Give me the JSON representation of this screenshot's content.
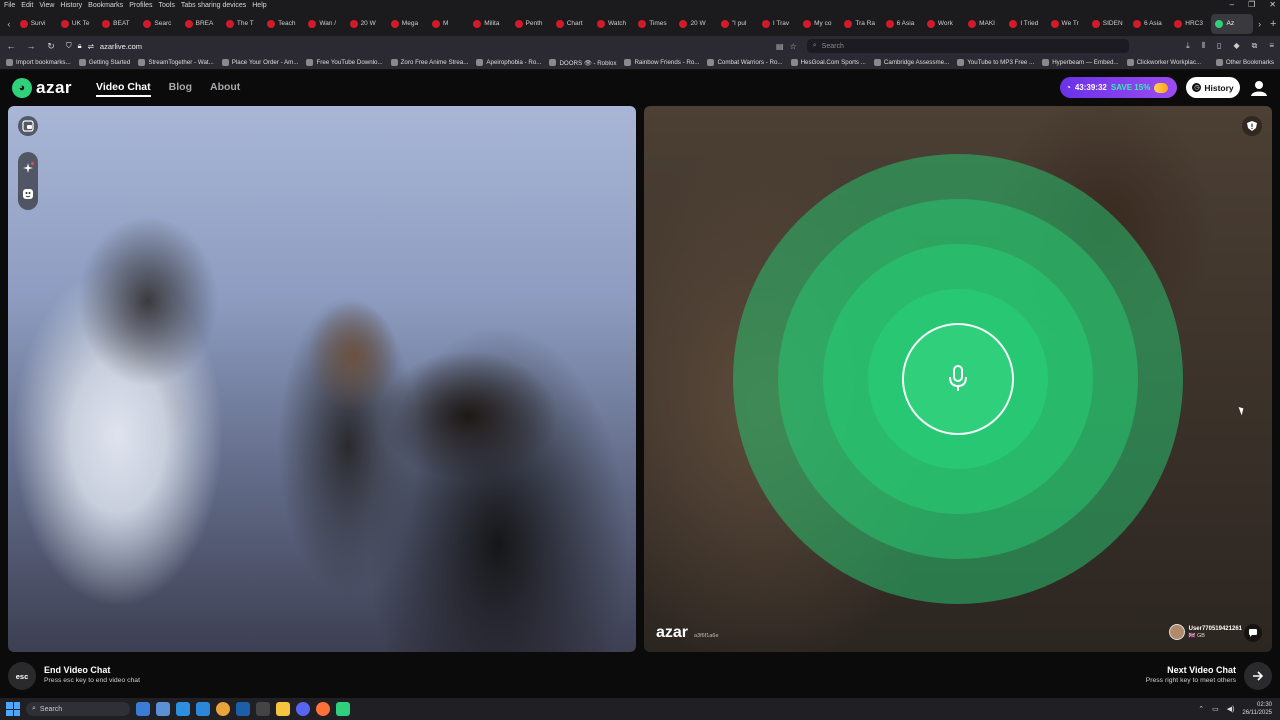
{
  "browser": {
    "menu": [
      "File",
      "Edit",
      "View",
      "History",
      "Bookmarks",
      "Profiles",
      "Tools",
      "Tabs sharing devices",
      "Help"
    ],
    "tabs": [
      "Survi",
      "UK Te",
      "BEAT",
      "Searc",
      "BREA",
      "The T",
      "Teach",
      "Wan /",
      "20 W",
      "Mega",
      "M",
      "Milita",
      "Penth",
      "Chart",
      "Watch",
      "Times",
      "20 W",
      "\"I pul",
      "I Trav",
      "My co",
      "Tra Ra",
      "6 Asia",
      "Work",
      "MAKI",
      "I Tried",
      "We Tr",
      "SIDEN",
      "6 Asia",
      "HRC3",
      "Az"
    ],
    "active_tab": "Az",
    "url": "azarlive.com",
    "search_placeholder": "Search",
    "bookmarks": [
      "Import bookmarks...",
      "Getting Started",
      "StreamTogether - Wat...",
      "Place Your Order - Am...",
      "Free YouTube Downlo...",
      "Zoro Free Anime Strea...",
      "Apeirophobia - Ro...",
      "DOORS 👁 - Roblox",
      "Rainbow Friends - Ro...",
      "Combat Warriors - Ro...",
      "HesGoal.Com Sports ...",
      "Cambridge Assessme...",
      "YouTube to MP3 Free ...",
      "Hyperbeam — Embed...",
      "Clickworker Workplac..."
    ],
    "other_bookmarks": "Other Bookmarks"
  },
  "header": {
    "logo_text": "azar",
    "nav": [
      {
        "label": "Video Chat",
        "active": true
      },
      {
        "label": "Blog",
        "active": false
      },
      {
        "label": "About",
        "active": false
      }
    ],
    "promo_timer": "43:39:32",
    "promo_save": "SAVE 15%",
    "history_label": "History"
  },
  "remote": {
    "watermark": "azar",
    "watermark_id": "a3f6f1a6e",
    "peer_name": "User770519421261",
    "peer_country": "🇬🇧 GB"
  },
  "footer": {
    "end_key": "esc",
    "end_title": "End Video Chat",
    "end_sub": "Press esc key to end video chat",
    "next_title": "Next Video Chat",
    "next_sub": "Press right key to meet others"
  },
  "taskbar": {
    "search_label": "Search",
    "time": "02:30",
    "date": "26/11/2025"
  },
  "colors": {
    "brand_green": "#2fcf7c",
    "promo_purple": "#7b3ceb",
    "background": "#0b0b0c"
  }
}
